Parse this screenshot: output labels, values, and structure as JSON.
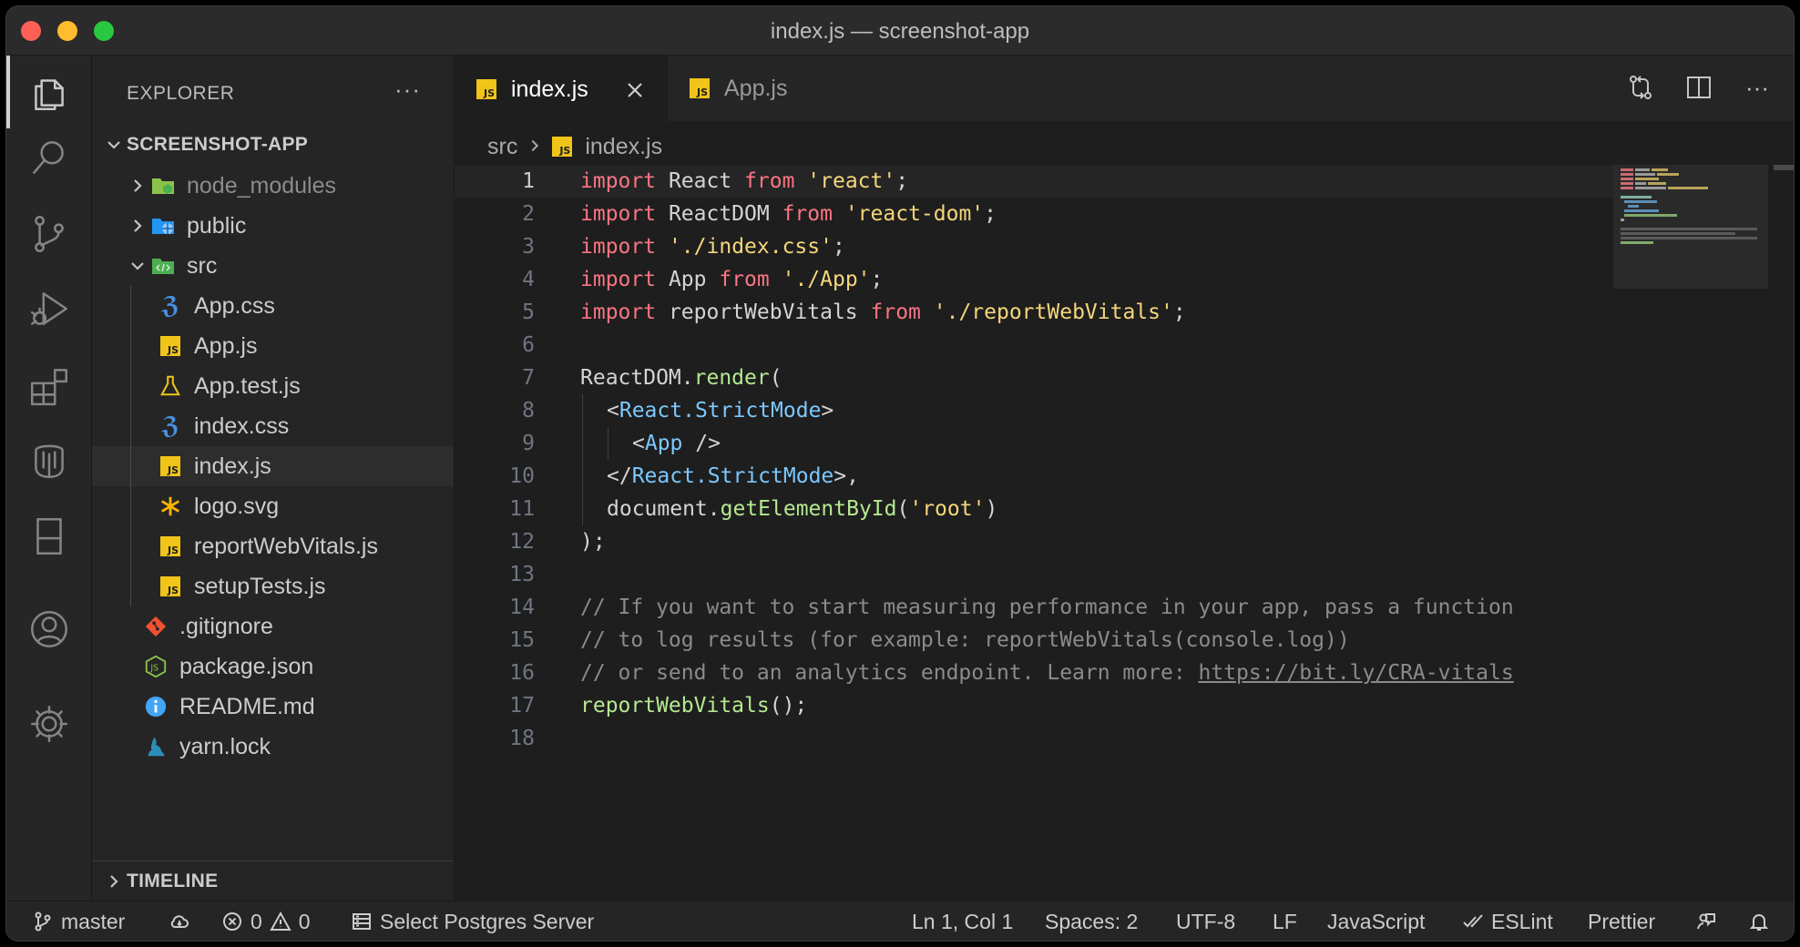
{
  "window": {
    "title": "index.js — screenshot-app"
  },
  "activity_bar": {
    "items": [
      "explorer-icon",
      "search-icon",
      "source-control-icon",
      "run-debug-icon",
      "extensions-icon",
      "database-icon",
      "remote-explorer-icon",
      "accounts-icon",
      "settings-gear-icon"
    ]
  },
  "sidebar": {
    "title": "EXPLORER",
    "more": "···",
    "project": "SCREENSHOT-APP",
    "tree": [
      {
        "label": "node_modules",
        "type": "folder",
        "icon": "node-folder-icon"
      },
      {
        "label": "public",
        "type": "folder",
        "icon": "public-folder-icon"
      },
      {
        "label": "src",
        "type": "folder-open",
        "icon": "src-folder-icon"
      },
      {
        "label": "App.css",
        "icon": "css-file-icon"
      },
      {
        "label": "App.js",
        "icon": "js-file-icon"
      },
      {
        "label": "App.test.js",
        "icon": "test-flask-icon"
      },
      {
        "label": "index.css",
        "icon": "css-file-icon"
      },
      {
        "label": "index.js",
        "icon": "js-file-icon"
      },
      {
        "label": "logo.svg",
        "icon": "svg-asterisk-icon"
      },
      {
        "label": "reportWebVitals.js",
        "icon": "js-file-icon"
      },
      {
        "label": "setupTests.js",
        "icon": "js-file-icon"
      },
      {
        "label": ".gitignore",
        "icon": "git-icon"
      },
      {
        "label": "package.json",
        "icon": "nodejs-icon"
      },
      {
        "label": "README.md",
        "icon": "info-icon"
      },
      {
        "label": "yarn.lock",
        "icon": "yarn-icon"
      }
    ],
    "timeline": "TIMELINE"
  },
  "tabs": [
    {
      "label": "index.js",
      "active": true
    },
    {
      "label": "App.js",
      "active": false
    }
  ],
  "breadcrumb": {
    "folder": "src",
    "file": "index.js"
  },
  "editor": {
    "line_numbers": [
      "1",
      "2",
      "3",
      "4",
      "5",
      "6",
      "7",
      "8",
      "9",
      "10",
      "11",
      "12",
      "13",
      "14",
      "15",
      "16",
      "17",
      "18"
    ],
    "lines": {
      "l1": {
        "a": "import",
        "b": " React ",
        "c": "from",
        "d": " ",
        "e": "'react'",
        "f": ";"
      },
      "l2": {
        "a": "import",
        "b": " ReactDOM ",
        "c": "from",
        "d": " ",
        "e": "'react-dom'",
        "f": ";"
      },
      "l3": {
        "a": "import",
        "b": " ",
        "e": "'./index.css'",
        "f": ";"
      },
      "l4": {
        "a": "import",
        "b": " App ",
        "c": "from",
        "d": " ",
        "e": "'./App'",
        "f": ";"
      },
      "l5": {
        "a": "import",
        "b": " reportWebVitals ",
        "c": "from",
        "d": " ",
        "e": "'./reportWebVitals'",
        "f": ";"
      },
      "l7": {
        "a": "ReactDOM.",
        "b": "render",
        "c": "("
      },
      "l8": {
        "a": "<",
        "b": "React.StrictMode",
        "c": ">"
      },
      "l9": {
        "a": "<",
        "b": "App",
        "c": " />"
      },
      "l10": {
        "a": "</",
        "b": "React.StrictMode",
        "c": ">,"
      },
      "l11": {
        "a": "document.",
        "b": "getElementById",
        "c": "(",
        "d": "'root'",
        "e": ")"
      },
      "l12": {
        "a": ");"
      },
      "l14": {
        "a": "// If you want to start measuring performance in your app, pass a function"
      },
      "l15": {
        "a": "// to log results (for example: reportWebVitals(console.log))"
      },
      "l16": {
        "a": "// or send to an analytics endpoint. Learn more: ",
        "b": "https://bit.ly/CRA-vitals"
      },
      "l17": {
        "a": "reportWebVitals",
        "b": "();"
      }
    }
  },
  "statusbar": {
    "branch": "master",
    "errors": "0",
    "warnings": "0",
    "postgres": "Select Postgres Server",
    "position": "Ln 1, Col 1",
    "spaces": "Spaces: 2",
    "encoding": "UTF-8",
    "eol": "LF",
    "language": "JavaScript",
    "eslint": "ESLint",
    "prettier": "Prettier"
  },
  "colors": {
    "keyword": "#f97583",
    "string": "#f5d67b",
    "function": "#b5e890",
    "tag": "#7cc8ff",
    "comment": "#8b8b8b",
    "js_badge": "#f0c419"
  }
}
